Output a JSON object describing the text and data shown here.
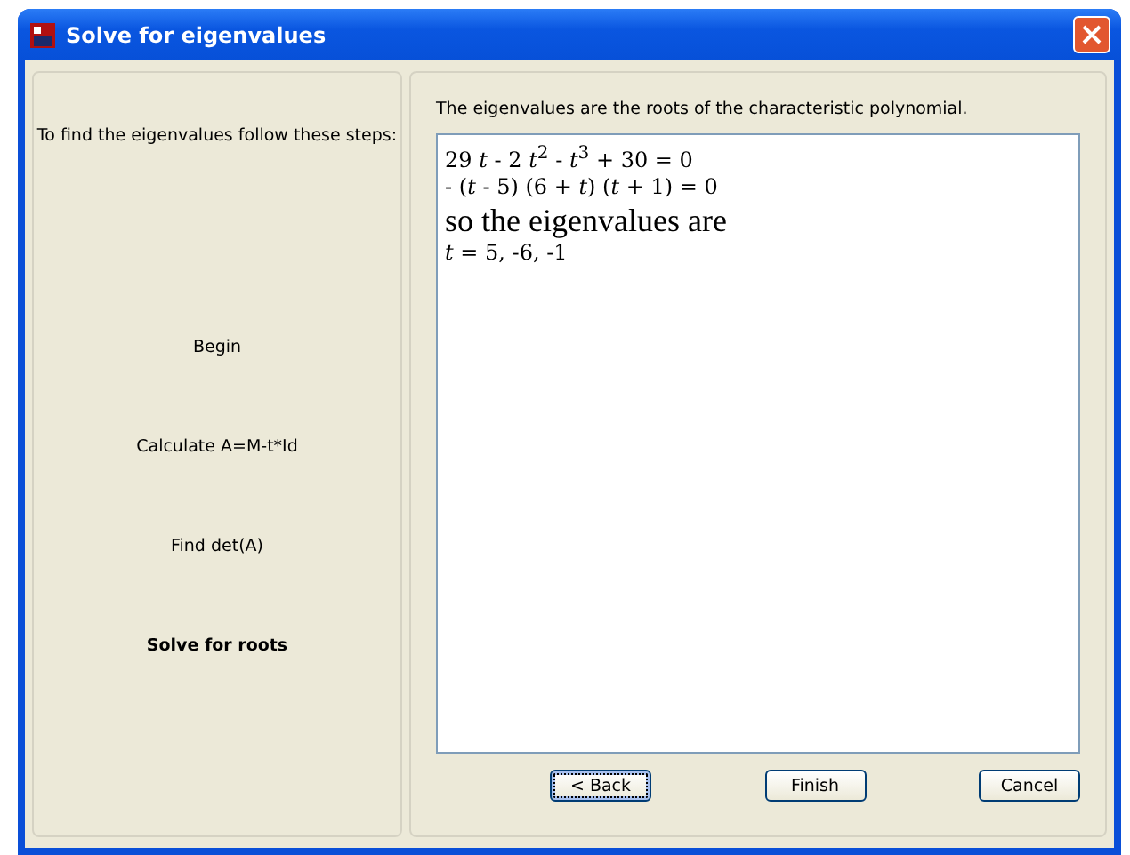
{
  "window": {
    "title": "Solve for eigenvalues"
  },
  "steps_panel": {
    "intro": "To find the eigenvalues follow these steps:",
    "steps": [
      {
        "label": "Begin",
        "selected": false
      },
      {
        "label": "Calculate A=M-t*Id",
        "selected": false
      },
      {
        "label": "Find det(A)",
        "selected": false
      },
      {
        "label": "Solve for roots",
        "selected": true
      }
    ]
  },
  "result_panel": {
    "caption": "The eigenvalues are the roots of the characteristic polynomial.",
    "lines": [
      {
        "kind": "math",
        "text": "29 *t* - 2 *t*$^{2}$ - *t*$^{3}$ + 30 = 0"
      },
      {
        "kind": "math",
        "text": "- (*t* - 5) (6 + *t*) (*t* + 1) = 0"
      },
      {
        "kind": "heading",
        "text": "so the eigenvalues are"
      },
      {
        "kind": "math",
        "text": "*t* = 5, -6, -1"
      }
    ]
  },
  "buttons": [
    {
      "label": "< Back",
      "focused": true
    },
    {
      "label": "Finish",
      "focused": false
    },
    {
      "label": "Cancel",
      "focused": false
    }
  ]
}
